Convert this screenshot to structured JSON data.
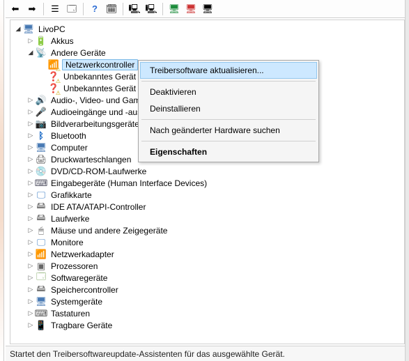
{
  "toolbar": {
    "back": "⬅",
    "forward": "➡",
    "show": "☰",
    "refresh": "🗔",
    "help": "?",
    "props": "🗓",
    "update": "⟳",
    "uninstall": "✖",
    "scan": "🔍",
    "disable": "⛔",
    "enable": "✅",
    "legacy": "📇"
  },
  "tree": {
    "root": {
      "label": "LivoPC"
    },
    "akkus": {
      "label": "Akkus"
    },
    "other": {
      "label": "Andere Geräte"
    },
    "netctrl": {
      "label": "Netzwerkcontroller"
    },
    "unk1": {
      "label": "Unbekanntes Gerät"
    },
    "unk2": {
      "label": "Unbekanntes Gerät"
    },
    "av": {
      "label": "Audio-, Video- und Gamecontroller"
    },
    "audio": {
      "label": "Audioeingänge und -ausgänge"
    },
    "img": {
      "label": "Bildverarbeitungsgeräte"
    },
    "bt": {
      "label": "Bluetooth"
    },
    "comp": {
      "label": "Computer"
    },
    "print": {
      "label": "Druckwarteschlangen"
    },
    "dvd": {
      "label": "DVD/CD-ROM-Laufwerke"
    },
    "hid": {
      "label": "Eingabegeräte (Human Interface Devices)"
    },
    "gfx": {
      "label": "Grafikkarte"
    },
    "ide": {
      "label": "IDE ATA/ATAPI-Controller"
    },
    "disk": {
      "label": "Laufwerke"
    },
    "mouse": {
      "label": "Mäuse und andere Zeigegeräte"
    },
    "mon": {
      "label": "Monitore"
    },
    "neta": {
      "label": "Netzwerkadapter"
    },
    "cpu": {
      "label": "Prozessoren"
    },
    "sw": {
      "label": "Softwaregeräte"
    },
    "mem": {
      "label": "Speichercontroller"
    },
    "sys": {
      "label": "Systemgeräte"
    },
    "kb": {
      "label": "Tastaturen"
    },
    "port": {
      "label": "Tragbare Geräte"
    }
  },
  "menu": {
    "update": "Treibersoftware aktualisieren...",
    "disable": "Deaktivieren",
    "uninstall": "Deinstallieren",
    "scan": "Nach geänderter Hardware suchen",
    "props": "Eigenschaften"
  },
  "status": "Startet den Treibersoftwareupdate-Assistenten für das ausgewählte Gerät."
}
